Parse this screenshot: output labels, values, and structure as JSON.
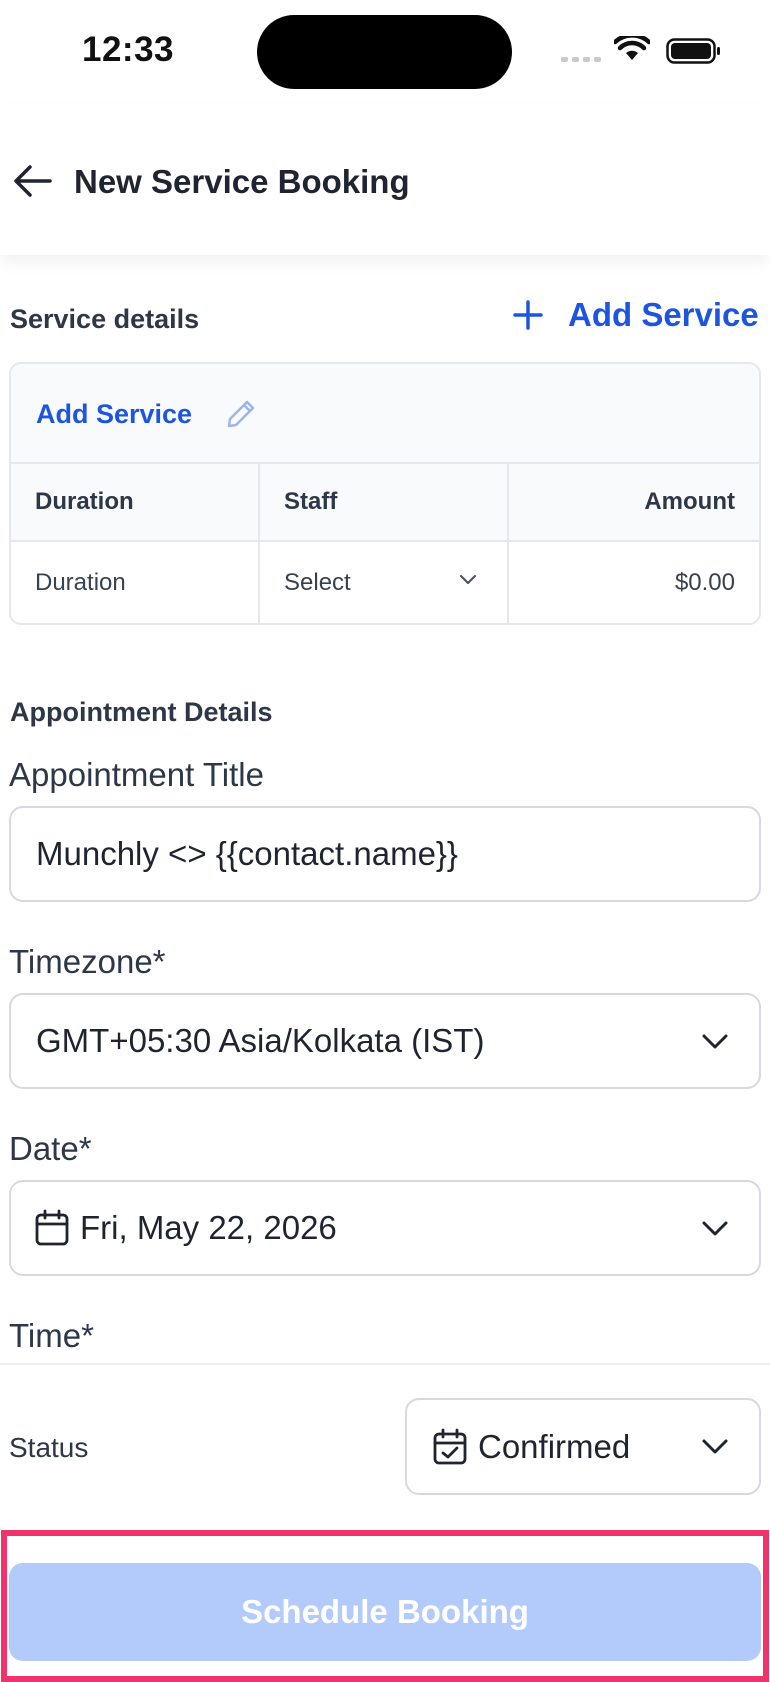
{
  "status_bar": {
    "time": "12:33"
  },
  "header": {
    "title": "New Service Booking"
  },
  "service_details": {
    "section_title": "Service details",
    "add_service_link": "Add Service",
    "card": {
      "service_name": "Add Service",
      "columns": [
        "Duration",
        "Staff",
        "Amount"
      ],
      "values": {
        "duration": "Duration",
        "staff": "Select",
        "amount": "$0.00"
      }
    }
  },
  "appointment": {
    "section_title": "Appointment Details",
    "title_label": "Appointment Title",
    "title_value": "Munchly <> {{contact.name}}",
    "timezone_label": "Timezone*",
    "timezone_value": "GMT+05:30 Asia/Kolkata (IST)",
    "date_label": "Date*",
    "date_value": "Fri, May 22, 2026",
    "time_label": "Time*",
    "status_label": "Status",
    "status_value": "Confirmed"
  },
  "footer": {
    "button_label": "Schedule Booking"
  },
  "colors": {
    "accent": "#1d55e0",
    "button_disabled": "#b3cbfb",
    "highlight": "#f0326d"
  }
}
